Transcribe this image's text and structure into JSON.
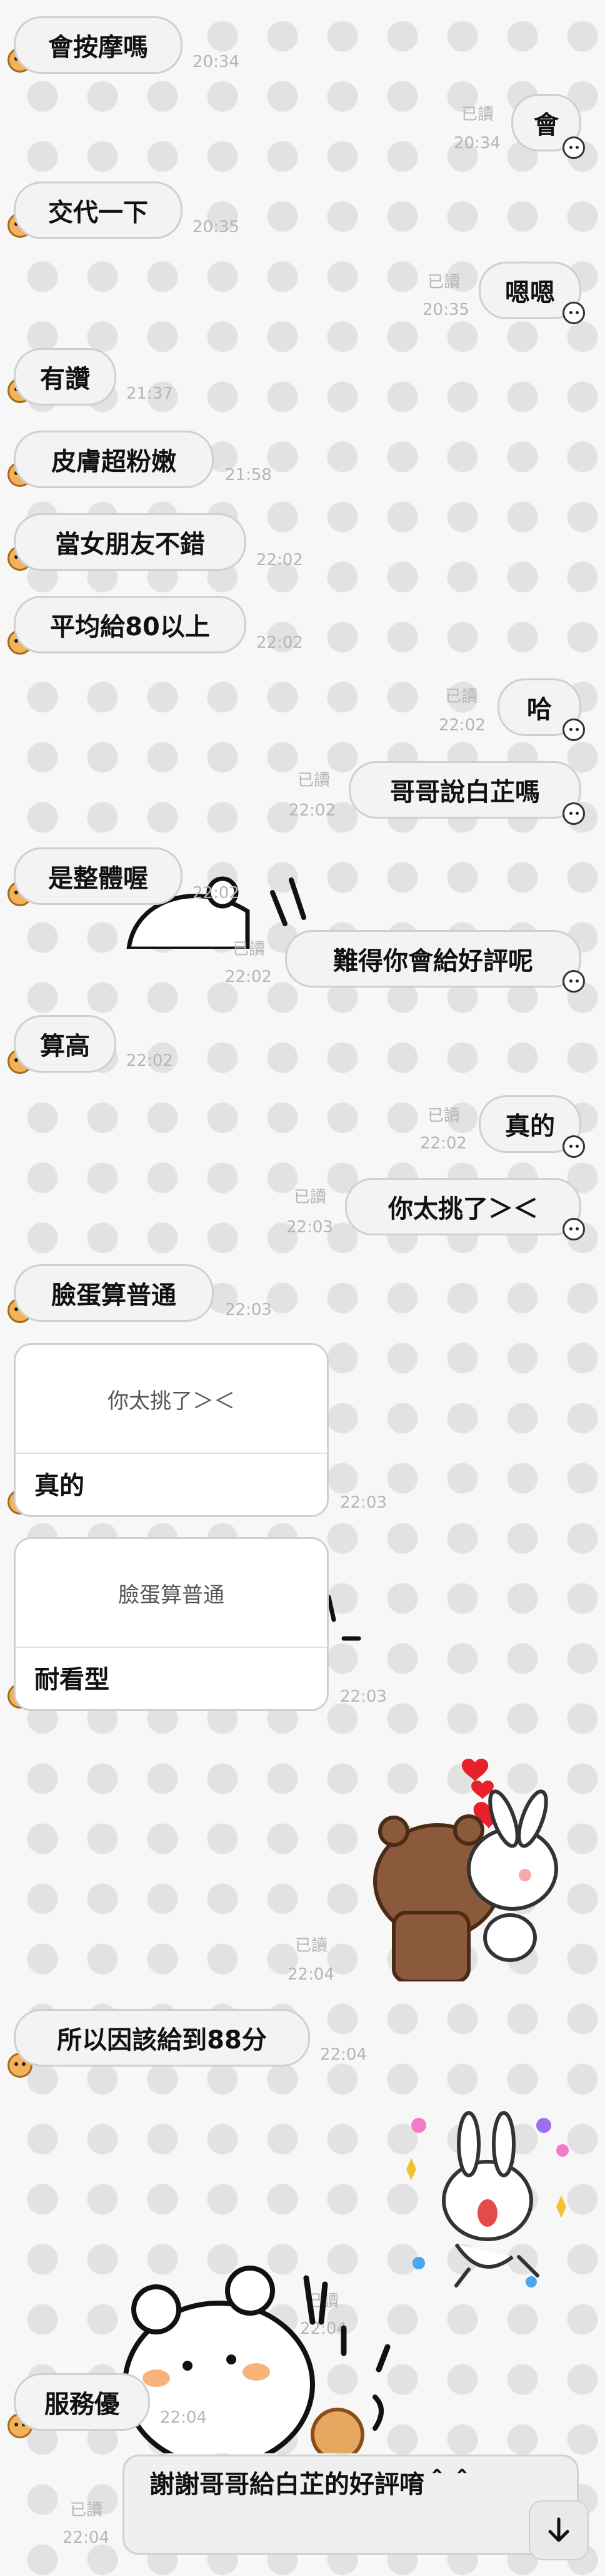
{
  "messages": [
    {
      "text": "會按摩嗎",
      "time": "20:34"
    },
    {
      "text": "會",
      "time": "20:34",
      "read": "已讀"
    },
    {
      "text": "交代一下",
      "time": "20:35"
    },
    {
      "text": "嗯嗯",
      "time": "20:35",
      "read": "已讀"
    },
    {
      "text": "有讚",
      "time": "21:37"
    },
    {
      "text": "皮膚超粉嫩",
      "time": "21:58"
    },
    {
      "text": "當女朋友不錯",
      "time": "22:02"
    },
    {
      "text": "平均給80以上",
      "time": "22:02"
    },
    {
      "text": "哈",
      "time": "22:02",
      "read": "已讀"
    },
    {
      "text": "哥哥說白芷嗎",
      "time": "22:02",
      "read": "已讀"
    },
    {
      "text": "是整體喔",
      "time": "22:02"
    },
    {
      "text": "難得你會給好評呢",
      "time": "22:02",
      "read": "已讀"
    },
    {
      "text": "算高",
      "time": "22:02"
    },
    {
      "text": "真的",
      "time": "22:02",
      "read": "已讀"
    },
    {
      "text": "你太挑了＞＜",
      "time": "22:03",
      "read": "已讀"
    },
    {
      "text": "臉蛋算普通",
      "time": "22:03"
    },
    {
      "quoted": "你太挑了＞＜",
      "text": "真的",
      "time": "22:03"
    },
    {
      "quoted": "臉蛋算普通",
      "text": "耐看型",
      "time": "22:03"
    },
    {
      "sticker": "bear-bunny-hug-sticker",
      "time": "22:04",
      "read": "已讀"
    },
    {
      "text": "所以因該給到88分",
      "time": "22:04"
    },
    {
      "sticker": "bunny-dance-sticker",
      "time": "22:04",
      "read": "已讀"
    },
    {
      "text": "服務優",
      "time": "22:04"
    }
  ],
  "composer": {
    "text": "謝謝哥哥給白芷的好評唷＾＾",
    "read": "已讀",
    "time": "22:04"
  },
  "colors": {
    "bubble": "#f3f3f3",
    "bubble_border": "#cfcfcf",
    "meta": "#b5b5b5",
    "background": "#f7f7f7"
  }
}
